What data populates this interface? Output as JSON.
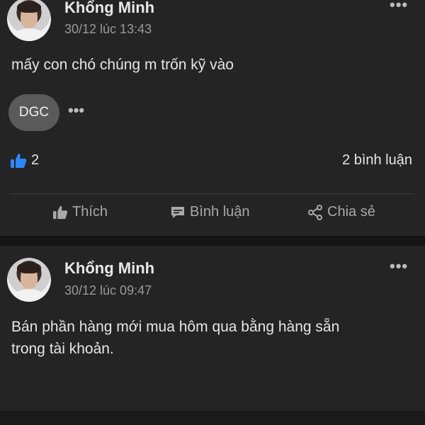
{
  "posts": [
    {
      "author": "Khổng Minh",
      "time": "30/12 lúc 13:43",
      "text": "mấy con chó chúng m trốn kỹ vào",
      "reaction_chip": "DGC",
      "likes_count": "2",
      "comments_count": "2 bình luận",
      "actions": {
        "like": "Thích",
        "comment": "Bình luận",
        "share": "Chia sẻ"
      }
    },
    {
      "author": "Khổng Minh",
      "time": "30/12 lúc 09:47",
      "text_line1": "Bán phần hàng mới mua hôm qua bằng hàng sẵn",
      "text_line2": "trong tài khoản."
    }
  ],
  "icons": {
    "more": "more-horizontal-icon",
    "like": "thumbs-up-icon",
    "comment": "comment-icon",
    "share": "share-icon"
  },
  "colors": {
    "like_blue": "#2d88ff",
    "background": "#242424"
  }
}
